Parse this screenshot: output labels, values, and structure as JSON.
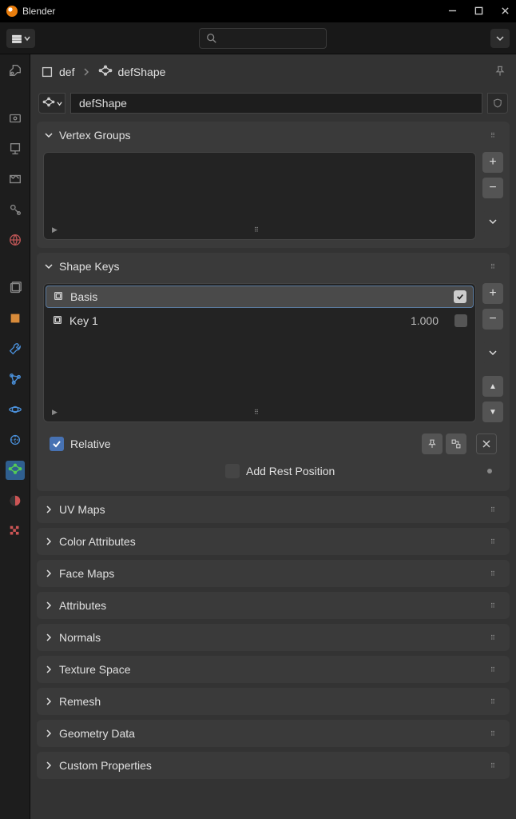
{
  "app_title": "Blender",
  "breadcrumb": {
    "object": "def",
    "data": "defShape"
  },
  "mesh_name": "defShape",
  "panels": {
    "vertex_groups": {
      "title": "Vertex Groups"
    },
    "shape_keys": {
      "title": "Shape Keys",
      "items": [
        {
          "label": "Basis",
          "value": "",
          "checked": true,
          "selected": true
        },
        {
          "label": "Key 1",
          "value": "1.000",
          "checked": false,
          "selected": false
        }
      ],
      "relative_label": "Relative",
      "relative_checked": true,
      "add_rest_label": "Add Rest Position",
      "add_rest_checked": false
    },
    "collapsed": [
      "UV Maps",
      "Color Attributes",
      "Face Maps",
      "Attributes",
      "Normals",
      "Texture Space",
      "Remesh",
      "Geometry Data",
      "Custom Properties"
    ]
  }
}
